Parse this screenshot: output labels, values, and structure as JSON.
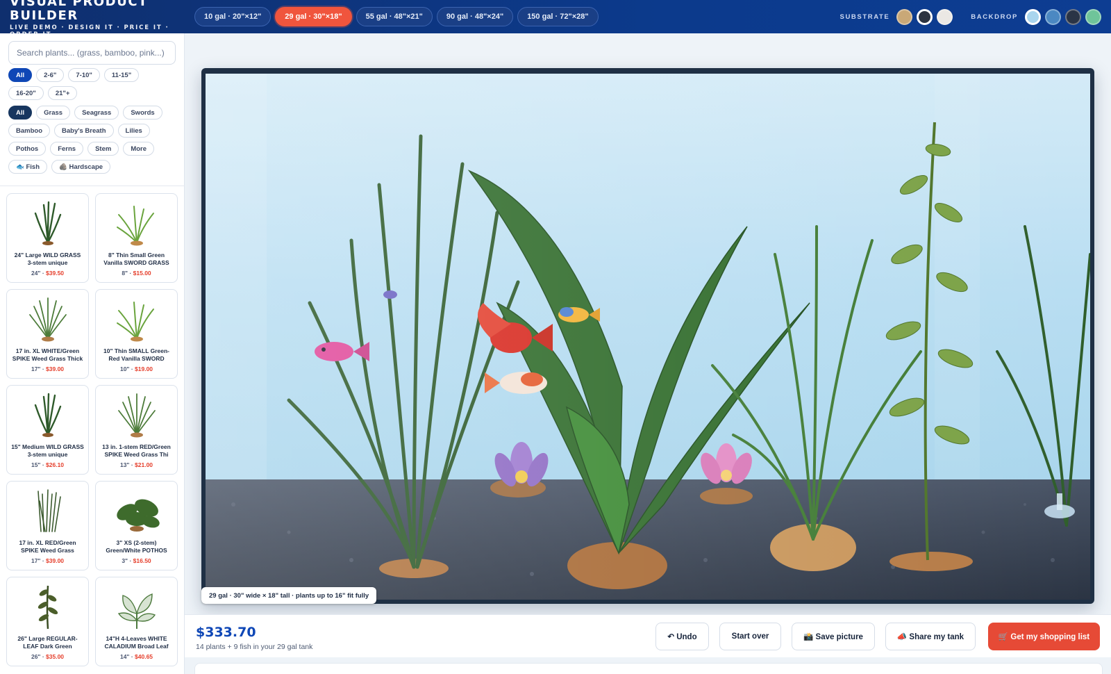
{
  "header": {
    "title": "VISUAL PRODUCT BUILDER",
    "tagline": "LIVE DEMO · DESIGN IT · PRICE IT · ORDER IT",
    "tank_sizes": [
      {
        "label": "10 gal · 20\"×12\"",
        "active": false
      },
      {
        "label": "29 gal · 30\"×18\"",
        "active": true
      },
      {
        "label": "55 gal · 48\"×21\"",
        "active": false
      },
      {
        "label": "90 gal · 48\"×24\"",
        "active": false
      },
      {
        "label": "150 gal · 72\"×28\"",
        "active": false
      }
    ],
    "substrate_label": "SUBSTRATE",
    "substrate_colors": [
      "#c9a877",
      "#2d3441",
      "#ebe8e4"
    ],
    "substrate_selected": 1,
    "backdrop_label": "BACKDROP",
    "backdrop_colors": [
      "#a9d5ee",
      "#4b88c2",
      "#2a3446",
      "#6fc49a"
    ],
    "backdrop_selected": 0
  },
  "sidebar": {
    "search_placeholder": "Search plants... (grass, bamboo, pink...)",
    "height_filters": [
      "All",
      "2-6\"",
      "7-10\"",
      "11-15\"",
      "16-20\"",
      "21\"+"
    ],
    "category_filters": [
      "All",
      "Grass",
      "Seagrass",
      "Swords",
      "Bamboo",
      "Baby's Breath",
      "Lilies",
      "Pothos",
      "Ferns",
      "Stem",
      "More",
      "🐟 Fish",
      "🪨 Hardscape"
    ],
    "products": [
      {
        "name": "24\" Large WILD GRASS 3-stem unique",
        "height": "24\"",
        "price": "$39.50",
        "kind": "grass"
      },
      {
        "name": "8\" Thin Small Green Vanilla SWORD GRASS",
        "height": "8\"",
        "price": "$15.00",
        "kind": "sword"
      },
      {
        "name": "17 in. XL WHITE/Green SPIKE Weed Grass Thick",
        "height": "17\"",
        "price": "$39.00",
        "kind": "spike"
      },
      {
        "name": "10\" Thin SMALL Green-Red Vanilla SWORD",
        "height": "10\"",
        "price": "$19.00",
        "kind": "sword"
      },
      {
        "name": "15\" Medium WILD GRASS 3-stem unique",
        "height": "15\"",
        "price": "$26.10",
        "kind": "grass"
      },
      {
        "name": "13 in. 1-stem RED/Green SPIKE Weed Grass Thi",
        "height": "13\"",
        "price": "$21.00",
        "kind": "spike"
      },
      {
        "name": "17 in. XL RED/Green SPIKE Weed Grass",
        "height": "17\"",
        "price": "$39.00",
        "kind": "weed"
      },
      {
        "name": "3\" XS (2-stem) Green/White POTHOS",
        "height": "3\"",
        "price": "$16.50",
        "kind": "pothos"
      },
      {
        "name": "26\" Large REGULAR-LEAF Dark Green",
        "height": "26\"",
        "price": "$35.00",
        "kind": "stem"
      },
      {
        "name": "14\"H 4-Leaves WHITE CALADIUM Broad Leaf",
        "height": "14\"",
        "price": "$40.65",
        "kind": "caladium"
      }
    ]
  },
  "stage": {
    "caption": "29 gal · 30\" wide × 18\" tall · plants up to 16\" fit fully"
  },
  "footer": {
    "total": "$333.70",
    "summary": "14 plants + 9 fish in your 29 gal tank",
    "undo": "↶ Undo",
    "start_over": "Start over",
    "save_picture": "📸 Save picture",
    "share": "📣 Share my tank",
    "shopping_list": "🛒 Get my shopping list"
  }
}
